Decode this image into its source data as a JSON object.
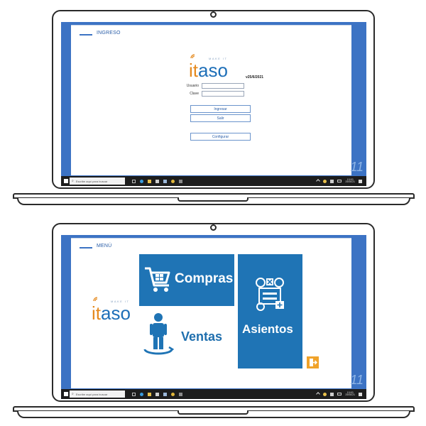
{
  "login": {
    "title": "INGRESO",
    "logo": {
      "it": "it",
      "aso": "aso",
      "tagline": "MAKE IT"
    },
    "version": "v25/6/2021",
    "fields": [
      {
        "label": "Usuario",
        "value": ""
      },
      {
        "label": "Clave",
        "value": ""
      }
    ],
    "buttons": {
      "ingresar": "Ingresar",
      "salir": "Salir",
      "configurar": "Configurar"
    }
  },
  "menu": {
    "title": "MENÚ",
    "logo": {
      "it": "it",
      "aso": "aso",
      "tagline": "MAKE IT"
    },
    "tiles": {
      "compras": "Compras",
      "ventas": "Ventas",
      "asientos": "Asientos"
    }
  },
  "taskbar": {
    "search_placeholder": "Escribe aquí para buscar",
    "time": "10:00",
    "date": "25/06/21"
  },
  "os_mark": "11",
  "colors": {
    "desktop": "#3c73c4",
    "tile": "#1f74b5",
    "logo_orange": "#e58a1f",
    "logo_blue": "#1e6fb8",
    "exit": "#f0a32a"
  }
}
